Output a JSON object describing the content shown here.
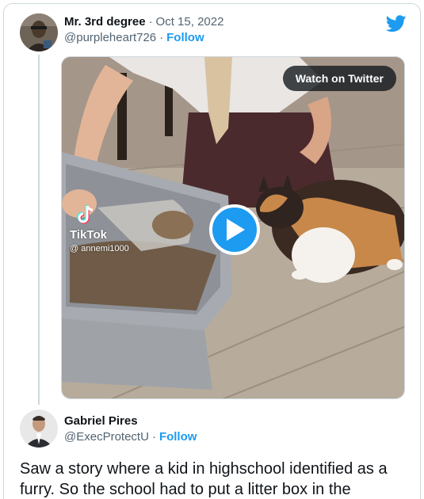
{
  "tweet1": {
    "display_name": "Mr. 3rd degree",
    "separator": "·",
    "date": "Oct 15, 2022",
    "handle": "@purpleheart726",
    "handle_sep": "·",
    "follow_label": "Follow",
    "avatar_icon": "avatar-photo-icon"
  },
  "media": {
    "watch_label": "Watch on Twitter",
    "tiktok_word": "TikTok",
    "tiktok_user": "@ annemi1000",
    "play_icon": "play-icon"
  },
  "tweet2": {
    "display_name": "Gabriel Pires",
    "handle": "@ExecProtectU",
    "handle_sep": "·",
    "follow_label": "Follow",
    "text": "Saw a story where a kid in highschool identified as a furry. So the school had to put a litter box in the"
  },
  "colors": {
    "accent": "#1d9bf0",
    "secondary_text": "#536471",
    "border": "#cfd9de"
  }
}
